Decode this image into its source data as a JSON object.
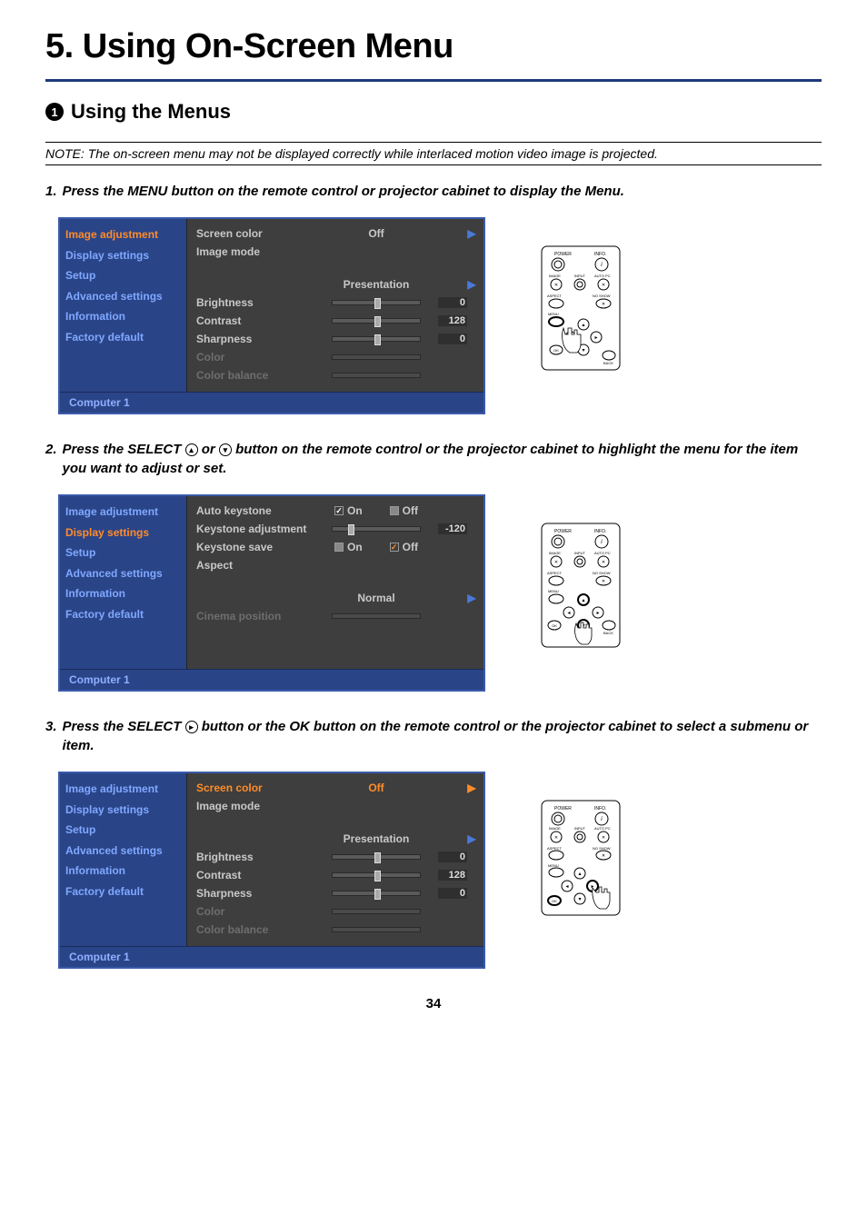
{
  "chapter_title": "5. Using On-Screen Menu",
  "section": {
    "bullet": "1",
    "title": "Using the Menus"
  },
  "note": "NOTE: The on-screen menu may not be displayed correctly while interlaced motion video image is projected.",
  "steps": {
    "s1": {
      "num": "1.",
      "text": "Press the MENU button on the remote control or projector cabinet to display the Menu."
    },
    "s2": {
      "num": "2.",
      "pre": "Press the SELECT ",
      "mid": " or ",
      "post": " button on the remote control or the projector cabinet to highlight the menu for the item you want to adjust or set."
    },
    "s3": {
      "num": "3.",
      "pre": "Press the SELECT ",
      "post": " button or the OK button on the remote control or the projector cabinet to select a submenu or item."
    }
  },
  "menu_items": {
    "image_adjustment": "Image adjustment",
    "display_settings": "Display settings",
    "setup": "Setup",
    "advanced_settings": "Advanced settings",
    "information": "Information",
    "factory_default": "Factory default"
  },
  "osd_common": {
    "footer": "Computer 1"
  },
  "osd1": {
    "screen_color": {
      "label": "Screen color",
      "value": "Off"
    },
    "image_mode": {
      "label": "Image mode",
      "value": "Presentation"
    },
    "brightness": {
      "label": "Brightness",
      "value": "0"
    },
    "contrast": {
      "label": "Contrast",
      "value": "128"
    },
    "sharpness": {
      "label": "Sharpness",
      "value": "0"
    },
    "color": {
      "label": "Color"
    },
    "color_balance": {
      "label": "Color balance"
    }
  },
  "osd2": {
    "auto_keystone": {
      "label": "Auto keystone",
      "on": "On",
      "off": "Off"
    },
    "keystone_adjustment": {
      "label": "Keystone adjustment",
      "value": "-120"
    },
    "keystone_save": {
      "label": "Keystone save",
      "on": "On",
      "off": "Off"
    },
    "aspect": {
      "label": "Aspect",
      "value": "Normal"
    },
    "cinema_position": {
      "label": "Cinema position"
    }
  },
  "remote_labels": {
    "power": "POWER",
    "info": "INFO.",
    "image": "IMAGE",
    "input": "INPUT",
    "autopc": "AUTO PC",
    "aspect": "ASPECT",
    "noshow": "NO SHOW",
    "menu": "MENU",
    "ok": "OK",
    "back": "BACK"
  },
  "page_number": "34"
}
